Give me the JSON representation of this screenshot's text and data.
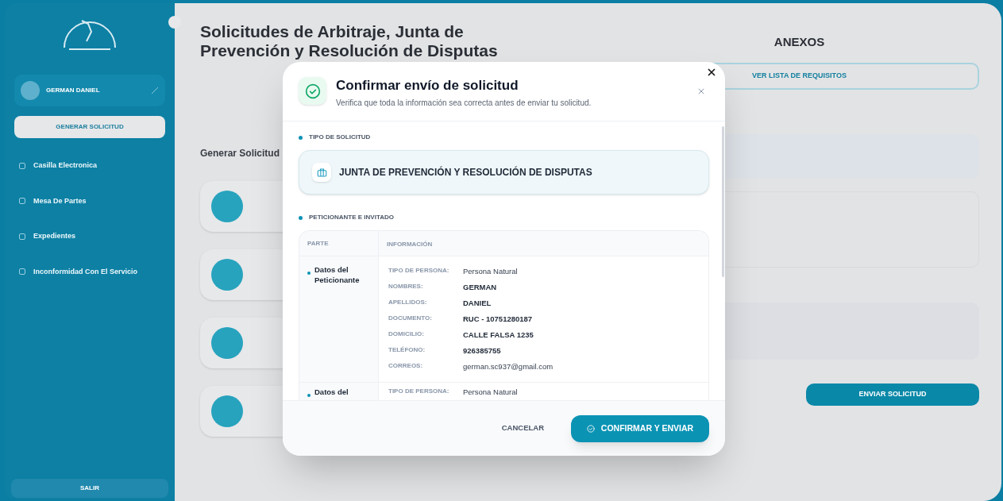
{
  "background": {
    "sidebar": {
      "user_name": "GERMAN DANIEL",
      "generate_button": "GENERAR SOLICITUD",
      "items": [
        {
          "label": "Casilla Electronica"
        },
        {
          "label": "Mesa De Partes"
        },
        {
          "label": "Expedientes"
        },
        {
          "label": "Inconformidad Con El Servicio"
        }
      ],
      "logout_button": "SALIR"
    },
    "main": {
      "title_lines": [
        "Solicitudes de Arbitraje, Junta de",
        "Prevención y Resolución de Disputas"
      ],
      "section_title": "Generar Solicitud"
    },
    "annex": {
      "title": "ANEXOS",
      "requirements_button": "VER LISTA DE REQUISITOS",
      "submit_button": "ENVIAR SOLICITUD"
    }
  },
  "modal": {
    "title": "Confirmar envío de solicitud",
    "subtitle": "Verifica que toda la información sea correcta antes de enviar tu solicitud.",
    "sections": [
      {
        "kind": "type",
        "label": "TIPO DE SOLICITUD",
        "value": "JUNTA DE PREVENCIÓN Y RESOLUCIÓN DE DISPUTAS"
      },
      {
        "kind": "table",
        "label": "PETICIONANTE E INVITADO",
        "columns": [
          "PARTE",
          "INFORMACIÓN"
        ],
        "rows": [
          {
            "party": "Datos del Peticionante",
            "fields": [
              {
                "label": "TIPO DE PERSONA:",
                "value": "Persona Natural",
                "emphasis": false
              },
              {
                "label": "NOMBRES:",
                "value": "GERMAN",
                "emphasis": true
              },
              {
                "label": "APELLIDOS:",
                "value": "DANIEL",
                "emphasis": true
              },
              {
                "label": "DOCUMENTO:",
                "value": "RUC - 10751280187",
                "emphasis": true
              },
              {
                "label": "DOMICILIO:",
                "value": "CALLE FALSA 1235",
                "emphasis": true
              },
              {
                "label": "TELÉFONO:",
                "value": "926385755",
                "emphasis": true
              },
              {
                "label": "CORREOS:",
                "value": "german.sc937@gmail.com",
                "emphasis": false
              }
            ]
          },
          {
            "party": "Datos del",
            "fields": [
              {
                "label": "TIPO DE PERSONA:",
                "value": "Persona Natural",
                "emphasis": false
              }
            ]
          }
        ]
      }
    ],
    "cancel_button": "CANCELAR",
    "confirm_button": "CONFIRMAR Y ENVIAR"
  }
}
